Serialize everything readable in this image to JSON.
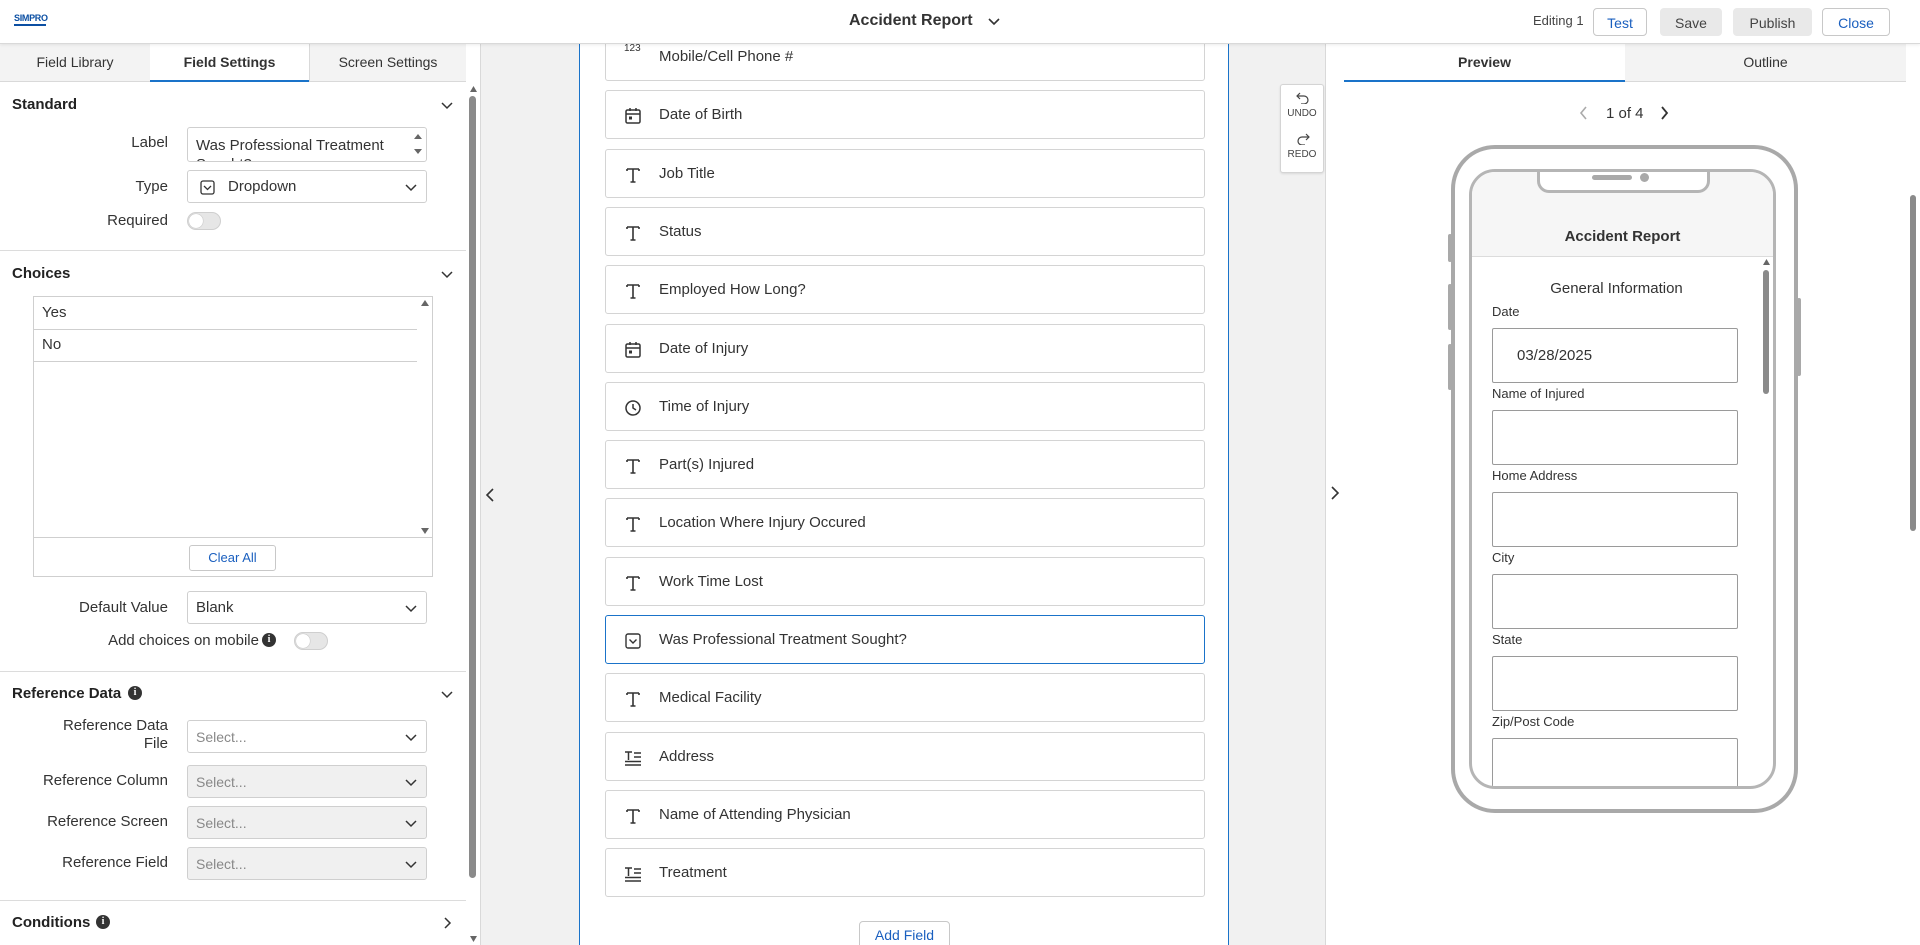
{
  "header": {
    "logo_text": "SIMPRO",
    "title": "Accident Report",
    "editing": "Editing 1",
    "buttons": {
      "test": "Test",
      "save": "Save",
      "publish": "Publish",
      "close": "Close"
    }
  },
  "left_panel": {
    "tabs": [
      "Field Library",
      "Field Settings",
      "Screen Settings"
    ],
    "active_tab": "Field Settings",
    "standard": {
      "heading": "Standard",
      "label_caption": "Label",
      "label_value": "Was Professional Treatment Sought?",
      "type_caption": "Type",
      "type_value": "Dropdown",
      "required_caption": "Required",
      "required": false
    },
    "choices": {
      "heading": "Choices",
      "items": [
        "Yes",
        "No"
      ],
      "clear_all": "Clear All",
      "default_caption": "Default Value",
      "default_value": "Blank",
      "add_mobile_caption": "Add choices on mobile",
      "add_mobile": false
    },
    "reference": {
      "heading": "Reference Data",
      "file_caption_1": "Reference Data",
      "file_caption_2": "File",
      "column_caption": "Reference Column",
      "screen_caption": "Reference Screen",
      "field_caption": "Reference Field",
      "placeholder": "Select..."
    },
    "conditions": {
      "heading": "Conditions"
    }
  },
  "canvas": {
    "fields": [
      {
        "label": "Mobile/Cell Phone #",
        "icon": "number-icon"
      },
      {
        "label": "Date of Birth",
        "icon": "calendar-icon"
      },
      {
        "label": "Job Title",
        "icon": "text-icon"
      },
      {
        "label": "Status",
        "icon": "text-icon"
      },
      {
        "label": "Employed How Long?",
        "icon": "text-icon"
      },
      {
        "label": "Date of Injury",
        "icon": "calendar-icon"
      },
      {
        "label": "Time of Injury",
        "icon": "clock-icon"
      },
      {
        "label": "Part(s) Injured",
        "icon": "text-icon"
      },
      {
        "label": "Location Where Injury Occured",
        "icon": "text-icon"
      },
      {
        "label": "Work Time Lost",
        "icon": "text-icon"
      },
      {
        "label": "Was Professional Treatment Sought?",
        "icon": "dropdown-icon",
        "selected": true
      },
      {
        "label": "Medical Facility",
        "icon": "text-icon"
      },
      {
        "label": "Address",
        "icon": "multiline-text-icon"
      },
      {
        "label": "Name of Attending Physician",
        "icon": "text-icon"
      },
      {
        "label": "Treatment",
        "icon": "multiline-text-icon"
      }
    ],
    "number_icon_text": "123",
    "add_field": "Add Field",
    "undo": "UNDO",
    "redo": "REDO"
  },
  "right_panel": {
    "tabs": [
      "Preview",
      "Outline"
    ],
    "active_tab": "Preview",
    "pager": "1 of 4",
    "phone": {
      "app_title": "Accident Report",
      "section": "General Information",
      "fields": [
        {
          "label": "Date",
          "value": "03/28/2025"
        },
        {
          "label": "Name of Injured",
          "value": ""
        },
        {
          "label": "Home Address",
          "value": ""
        },
        {
          "label": "City",
          "value": ""
        },
        {
          "label": "State",
          "value": ""
        },
        {
          "label": "Zip/Post Code",
          "value": ""
        }
      ]
    }
  },
  "colors": {
    "accent": "#1a73c9",
    "link": "#1a5fbf",
    "logo": "#0b4fa3"
  }
}
